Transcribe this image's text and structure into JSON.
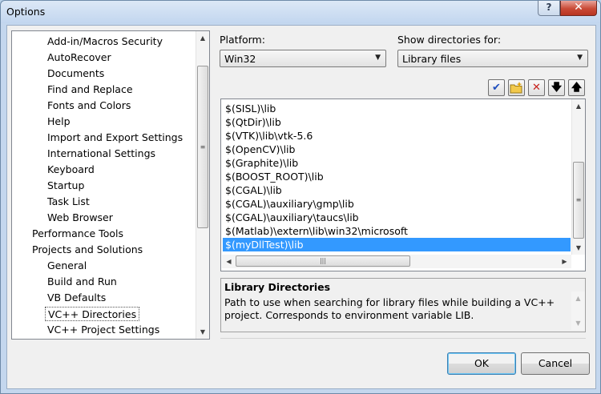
{
  "window": {
    "title": "Options",
    "help_label": "?",
    "close_label": "✕"
  },
  "tree": {
    "items": [
      {
        "label": "Add-in/Macros Security",
        "level": 1
      },
      {
        "label": "AutoRecover",
        "level": 1
      },
      {
        "label": "Documents",
        "level": 1
      },
      {
        "label": "Find and Replace",
        "level": 1
      },
      {
        "label": "Fonts and Colors",
        "level": 1
      },
      {
        "label": "Help",
        "level": 1
      },
      {
        "label": "Import and Export Settings",
        "level": 1
      },
      {
        "label": "International Settings",
        "level": 1
      },
      {
        "label": "Keyboard",
        "level": 1
      },
      {
        "label": "Startup",
        "level": 1
      },
      {
        "label": "Task List",
        "level": 1
      },
      {
        "label": "Web Browser",
        "level": 1
      },
      {
        "label": "Performance Tools",
        "level": 0
      },
      {
        "label": "Projects and Solutions",
        "level": 0
      },
      {
        "label": "General",
        "level": 1
      },
      {
        "label": "Build and Run",
        "level": 1
      },
      {
        "label": "VB Defaults",
        "level": 1
      },
      {
        "label": "VC++ Directories",
        "level": 1,
        "selected": true
      },
      {
        "label": "VC++ Project Settings",
        "level": 1
      }
    ]
  },
  "platform": {
    "label": "Platform:",
    "value": "Win32"
  },
  "show_dirs": {
    "label": "Show directories for:",
    "value": "Library files"
  },
  "toolbar": {
    "icons": [
      "check-icon",
      "new-folder-icon",
      "delete-icon",
      "move-down-icon",
      "move-up-icon"
    ]
  },
  "directories": [
    "$(SISL)\\lib",
    "$(QtDir)\\lib",
    "$(VTK)\\lib\\vtk-5.6",
    "$(OpenCV)\\lib",
    "$(Graphite)\\lib",
    "$(BOOST_ROOT)\\lib",
    "$(CGAL)\\lib",
    "$(CGAL)\\auxiliary\\gmp\\lib",
    "$(CGAL)\\auxiliary\\taucs\\lib",
    "$(Matlab)\\extern\\lib\\win32\\microsoft",
    "$(myDllTest)\\lib"
  ],
  "selected_directory_index": 10,
  "description": {
    "title": "Library Directories",
    "text": "Path to use when searching for library files while building a VC++ project.  Corresponds to environment variable LIB."
  },
  "buttons": {
    "ok": "OK",
    "cancel": "Cancel"
  },
  "colors": {
    "selection": "#3399ff",
    "dialog_bg": "#f0f0f0"
  }
}
